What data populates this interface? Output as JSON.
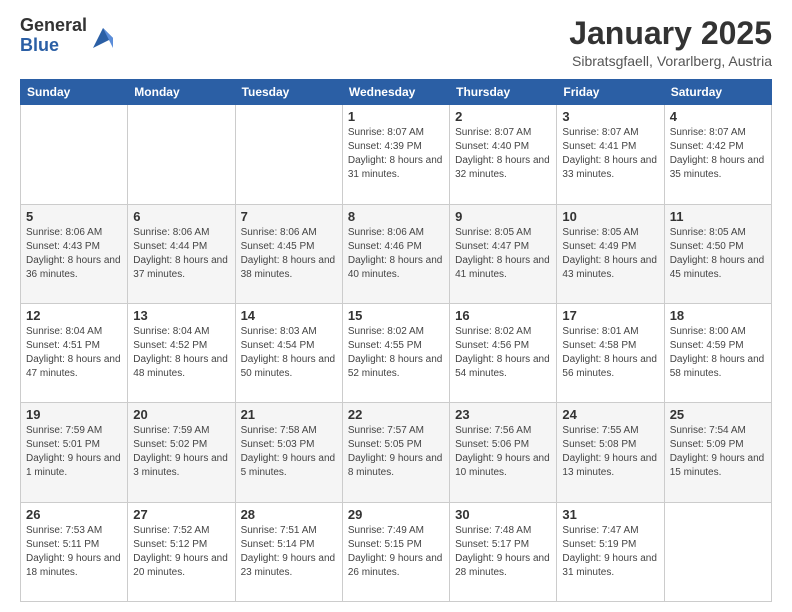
{
  "logo": {
    "general": "General",
    "blue": "Blue"
  },
  "header": {
    "month": "January 2025",
    "location": "Sibratsgfaell, Vorarlberg, Austria"
  },
  "weekdays": [
    "Sunday",
    "Monday",
    "Tuesday",
    "Wednesday",
    "Thursday",
    "Friday",
    "Saturday"
  ],
  "weeks": [
    [
      {
        "day": "",
        "info": ""
      },
      {
        "day": "",
        "info": ""
      },
      {
        "day": "",
        "info": ""
      },
      {
        "day": "1",
        "info": "Sunrise: 8:07 AM\nSunset: 4:39 PM\nDaylight: 8 hours and 31 minutes."
      },
      {
        "day": "2",
        "info": "Sunrise: 8:07 AM\nSunset: 4:40 PM\nDaylight: 8 hours and 32 minutes."
      },
      {
        "day": "3",
        "info": "Sunrise: 8:07 AM\nSunset: 4:41 PM\nDaylight: 8 hours and 33 minutes."
      },
      {
        "day": "4",
        "info": "Sunrise: 8:07 AM\nSunset: 4:42 PM\nDaylight: 8 hours and 35 minutes."
      }
    ],
    [
      {
        "day": "5",
        "info": "Sunrise: 8:06 AM\nSunset: 4:43 PM\nDaylight: 8 hours and 36 minutes."
      },
      {
        "day": "6",
        "info": "Sunrise: 8:06 AM\nSunset: 4:44 PM\nDaylight: 8 hours and 37 minutes."
      },
      {
        "day": "7",
        "info": "Sunrise: 8:06 AM\nSunset: 4:45 PM\nDaylight: 8 hours and 38 minutes."
      },
      {
        "day": "8",
        "info": "Sunrise: 8:06 AM\nSunset: 4:46 PM\nDaylight: 8 hours and 40 minutes."
      },
      {
        "day": "9",
        "info": "Sunrise: 8:05 AM\nSunset: 4:47 PM\nDaylight: 8 hours and 41 minutes."
      },
      {
        "day": "10",
        "info": "Sunrise: 8:05 AM\nSunset: 4:49 PM\nDaylight: 8 hours and 43 minutes."
      },
      {
        "day": "11",
        "info": "Sunrise: 8:05 AM\nSunset: 4:50 PM\nDaylight: 8 hours and 45 minutes."
      }
    ],
    [
      {
        "day": "12",
        "info": "Sunrise: 8:04 AM\nSunset: 4:51 PM\nDaylight: 8 hours and 47 minutes."
      },
      {
        "day": "13",
        "info": "Sunrise: 8:04 AM\nSunset: 4:52 PM\nDaylight: 8 hours and 48 minutes."
      },
      {
        "day": "14",
        "info": "Sunrise: 8:03 AM\nSunset: 4:54 PM\nDaylight: 8 hours and 50 minutes."
      },
      {
        "day": "15",
        "info": "Sunrise: 8:02 AM\nSunset: 4:55 PM\nDaylight: 8 hours and 52 minutes."
      },
      {
        "day": "16",
        "info": "Sunrise: 8:02 AM\nSunset: 4:56 PM\nDaylight: 8 hours and 54 minutes."
      },
      {
        "day": "17",
        "info": "Sunrise: 8:01 AM\nSunset: 4:58 PM\nDaylight: 8 hours and 56 minutes."
      },
      {
        "day": "18",
        "info": "Sunrise: 8:00 AM\nSunset: 4:59 PM\nDaylight: 8 hours and 58 minutes."
      }
    ],
    [
      {
        "day": "19",
        "info": "Sunrise: 7:59 AM\nSunset: 5:01 PM\nDaylight: 9 hours and 1 minute."
      },
      {
        "day": "20",
        "info": "Sunrise: 7:59 AM\nSunset: 5:02 PM\nDaylight: 9 hours and 3 minutes."
      },
      {
        "day": "21",
        "info": "Sunrise: 7:58 AM\nSunset: 5:03 PM\nDaylight: 9 hours and 5 minutes."
      },
      {
        "day": "22",
        "info": "Sunrise: 7:57 AM\nSunset: 5:05 PM\nDaylight: 9 hours and 8 minutes."
      },
      {
        "day": "23",
        "info": "Sunrise: 7:56 AM\nSunset: 5:06 PM\nDaylight: 9 hours and 10 minutes."
      },
      {
        "day": "24",
        "info": "Sunrise: 7:55 AM\nSunset: 5:08 PM\nDaylight: 9 hours and 13 minutes."
      },
      {
        "day": "25",
        "info": "Sunrise: 7:54 AM\nSunset: 5:09 PM\nDaylight: 9 hours and 15 minutes."
      }
    ],
    [
      {
        "day": "26",
        "info": "Sunrise: 7:53 AM\nSunset: 5:11 PM\nDaylight: 9 hours and 18 minutes."
      },
      {
        "day": "27",
        "info": "Sunrise: 7:52 AM\nSunset: 5:12 PM\nDaylight: 9 hours and 20 minutes."
      },
      {
        "day": "28",
        "info": "Sunrise: 7:51 AM\nSunset: 5:14 PM\nDaylight: 9 hours and 23 minutes."
      },
      {
        "day": "29",
        "info": "Sunrise: 7:49 AM\nSunset: 5:15 PM\nDaylight: 9 hours and 26 minutes."
      },
      {
        "day": "30",
        "info": "Sunrise: 7:48 AM\nSunset: 5:17 PM\nDaylight: 9 hours and 28 minutes."
      },
      {
        "day": "31",
        "info": "Sunrise: 7:47 AM\nSunset: 5:19 PM\nDaylight: 9 hours and 31 minutes."
      },
      {
        "day": "",
        "info": ""
      }
    ]
  ]
}
